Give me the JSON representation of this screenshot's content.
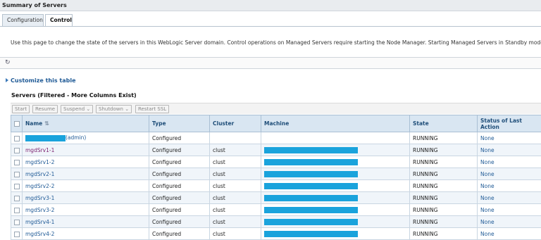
{
  "window": {
    "title": "Summary of Servers"
  },
  "tabs": [
    {
      "label": "Configuration",
      "active": false
    },
    {
      "label": "Control",
      "active": true
    }
  ],
  "description": "Use this page to change the state of the servers in this WebLogic Server domain. Control operations on Managed Servers require starting the Node Manager. Starting Managed Servers in Standby mode requires the domain",
  "icons": {
    "refresh": "refresh-icon",
    "expand": "expand-triangle-icon",
    "sort": "sort-icon"
  },
  "customize_label": "Customize this table",
  "table_title": "Servers (Filtered - More Columns Exist)",
  "toolbar": {
    "start": "Start",
    "resume": "Resume",
    "suspend": "Suspend",
    "shutdown": "Shutdown",
    "restart_ssl": "Restart SSL",
    "dropdown_glyph": "⌄"
  },
  "columns": [
    "Name",
    "Type",
    "Cluster",
    "Machine",
    "State",
    "Status of Last Action"
  ],
  "rows": [
    {
      "name": "(admin)",
      "type": "Configured",
      "cluster": "",
      "machine": "",
      "state": "RUNNING",
      "status": "None"
    },
    {
      "name": "mgdSrv1-1",
      "type": "Configured",
      "cluster": "clust",
      "machine": "",
      "state": "RUNNING",
      "status": "None"
    },
    {
      "name": "mgdSrv1-2",
      "type": "Configured",
      "cluster": "clust",
      "machine": "",
      "state": "RUNNING",
      "status": "None"
    },
    {
      "name": "mgdSrv2-1",
      "type": "Configured",
      "cluster": "clust",
      "machine": "",
      "state": "RUNNING",
      "status": "None"
    },
    {
      "name": "mgdSrv2-2",
      "type": "Configured",
      "cluster": "clust",
      "machine": "",
      "state": "RUNNING",
      "status": "None"
    },
    {
      "name": "mgdSrv3-1",
      "type": "Configured",
      "cluster": "clust",
      "machine": "",
      "state": "RUNNING",
      "status": "None"
    },
    {
      "name": "mgdSrv3-2",
      "type": "Configured",
      "cluster": "clust",
      "machine": "",
      "state": "RUNNING",
      "status": "None"
    },
    {
      "name": "mgdSrv4-1",
      "type": "Configured",
      "cluster": "clust",
      "machine": "",
      "state": "RUNNING",
      "status": "None"
    },
    {
      "name": "mgdSrv4-2",
      "type": "Configured",
      "cluster": "clust",
      "machine": "",
      "state": "RUNNING",
      "status": "None"
    }
  ],
  "colors": {
    "redaction": "#1aa3dc",
    "header_bg": "#d9e6f2",
    "link": "#1f5a96"
  }
}
